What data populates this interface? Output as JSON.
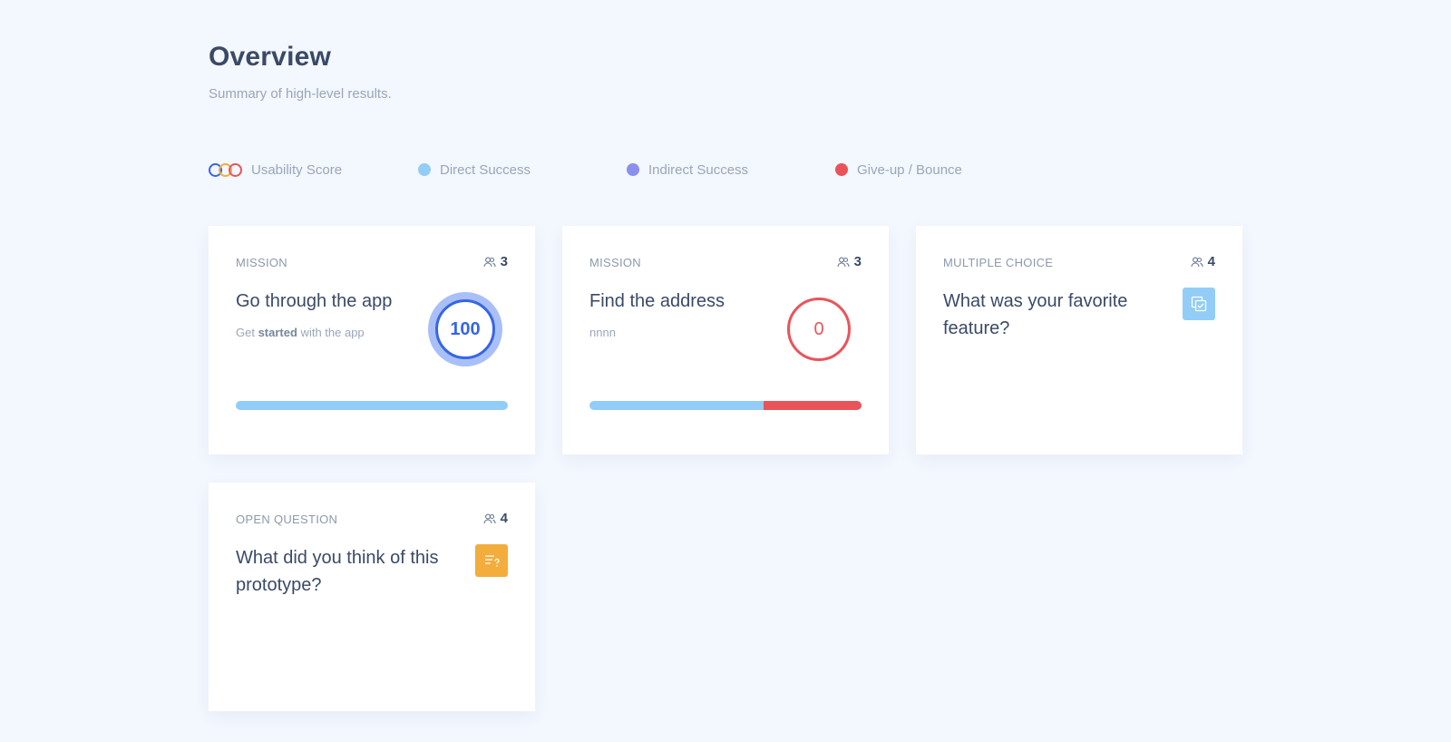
{
  "header": {
    "title": "Overview",
    "subtitle": "Summary of high-level results."
  },
  "legend": {
    "usability_score": "Usability Score",
    "direct_success": "Direct Success",
    "indirect_success": "Indirect Success",
    "giveup_bounce": "Give-up / Bounce",
    "colors": {
      "usability_rings": [
        "#3665e6",
        "#f2ad3c",
        "#e9545a"
      ],
      "direct": "#92cdf7",
      "indirect": "#8b8fef",
      "giveup": "#e9545a"
    }
  },
  "cards": [
    {
      "type": "MISSION",
      "participants": "3",
      "participants_icon": "users-icon",
      "title": "Go through the app",
      "desc_prefix": "Get ",
      "desc_bold": "started",
      "desc_suffix": " with the app",
      "score": "100",
      "bar": {
        "direct_fraction": 1.0,
        "indirect_fraction": 0.0,
        "giveup_fraction": 0.0
      }
    },
    {
      "type": "MISSION",
      "participants": "3",
      "participants_icon": "users-icon",
      "title": "Find the address",
      "desc": "nnnn",
      "score": "0",
      "bar": {
        "direct_fraction": 0.64,
        "indirect_fraction": 0.0,
        "giveup_fraction": 0.36
      }
    },
    {
      "type": "MULTIPLE CHOICE",
      "participants": "4",
      "participants_icon": "users-icon",
      "title": "What was your favorite feature?",
      "badge_icon": "multiple-choice-icon",
      "badge_color": "#92cdf7"
    },
    {
      "type": "OPEN QUESTION",
      "participants": "4",
      "participants_icon": "users-icon",
      "title": "What did you think of this prototype?",
      "badge_icon": "open-question-icon",
      "badge_color": "#f2ad3c"
    }
  ]
}
